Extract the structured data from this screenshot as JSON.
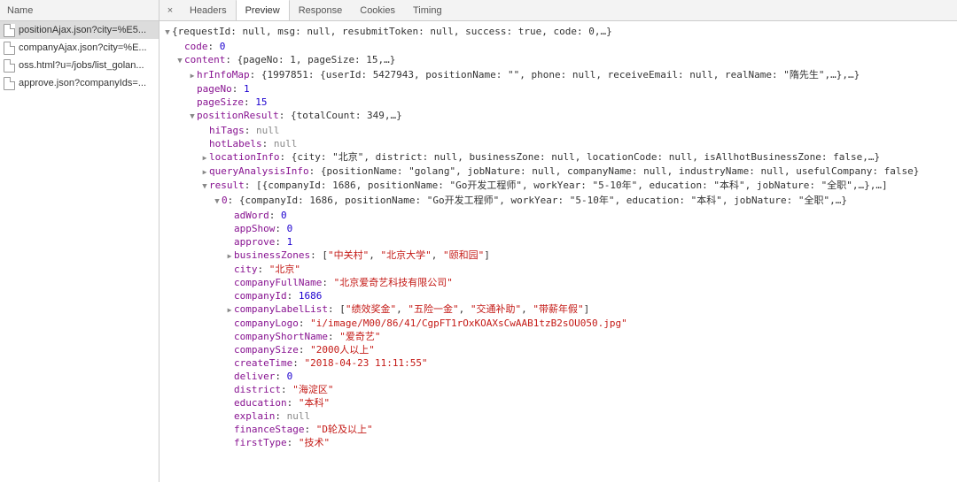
{
  "left_panel": {
    "header": "Name",
    "items": [
      {
        "label": "positionAjax.json?city=%E5...",
        "selected": true
      },
      {
        "label": "companyAjax.json?city=%E...",
        "selected": false
      },
      {
        "label": "oss.html?u=/jobs/list_golan...",
        "selected": false
      },
      {
        "label": "approve.json?companyIds=...",
        "selected": false
      }
    ]
  },
  "tabs": {
    "close": "×",
    "items": [
      "Headers",
      "Preview",
      "Response",
      "Cookies",
      "Timing"
    ],
    "active": 1
  },
  "tree": [
    {
      "d": 0,
      "a": "down",
      "pre": "",
      "key": "",
      "body": [
        [
          "summary",
          "{requestId: null, msg: null, resubmitToken: null, success: true, code: 0,…}"
        ]
      ]
    },
    {
      "d": 1,
      "a": "none",
      "key": "code",
      "body": [
        [
          "punc",
          ": "
        ],
        [
          "num",
          "0"
        ]
      ]
    },
    {
      "d": 1,
      "a": "down",
      "key": "content",
      "body": [
        [
          "punc",
          ": "
        ],
        [
          "summary",
          "{pageNo: 1, pageSize: 15,…}"
        ]
      ]
    },
    {
      "d": 2,
      "a": "right",
      "key": "hrInfoMap",
      "body": [
        [
          "punc",
          ": "
        ],
        [
          "summary",
          "{1997851: {userId: 5427943, positionName: \"\", phone: null, receiveEmail: null, realName: \"隋先生\",…},…}"
        ]
      ]
    },
    {
      "d": 2,
      "a": "none",
      "key": "pageNo",
      "body": [
        [
          "punc",
          ": "
        ],
        [
          "num",
          "1"
        ]
      ]
    },
    {
      "d": 2,
      "a": "none",
      "key": "pageSize",
      "body": [
        [
          "punc",
          ": "
        ],
        [
          "num",
          "15"
        ]
      ]
    },
    {
      "d": 2,
      "a": "down",
      "key": "positionResult",
      "body": [
        [
          "punc",
          ": "
        ],
        [
          "summary",
          "{totalCount: 349,…}"
        ]
      ]
    },
    {
      "d": 3,
      "a": "none",
      "key": "hiTags",
      "body": [
        [
          "punc",
          ": "
        ],
        [
          "null",
          "null"
        ]
      ]
    },
    {
      "d": 3,
      "a": "none",
      "key": "hotLabels",
      "body": [
        [
          "punc",
          ": "
        ],
        [
          "null",
          "null"
        ]
      ]
    },
    {
      "d": 3,
      "a": "right",
      "key": "locationInfo",
      "body": [
        [
          "punc",
          ": "
        ],
        [
          "summary",
          "{city: \"北京\", district: null, businessZone: null, locationCode: null, isAllhotBusinessZone: false,…}"
        ]
      ]
    },
    {
      "d": 3,
      "a": "right",
      "key": "queryAnalysisInfo",
      "body": [
        [
          "punc",
          ": "
        ],
        [
          "summary",
          "{positionName: \"golang\", jobNature: null, companyName: null, industryName: null, usefulCompany: false}"
        ]
      ]
    },
    {
      "d": 3,
      "a": "down",
      "key": "result",
      "body": [
        [
          "punc",
          ": "
        ],
        [
          "summary",
          "[{companyId: 1686, positionName: \"Go开发工程师\", workYear: \"5-10年\", education: \"本科\", jobNature: \"全职\",…},…]"
        ]
      ]
    },
    {
      "d": 4,
      "a": "down",
      "key": "0",
      "body": [
        [
          "punc",
          ": "
        ],
        [
          "summary",
          "{companyId: 1686, positionName: \"Go开发工程师\", workYear: \"5-10年\", education: \"本科\", jobNature: \"全职\",…}"
        ]
      ]
    },
    {
      "d": 5,
      "a": "none",
      "key": "adWord",
      "body": [
        [
          "punc",
          ": "
        ],
        [
          "num",
          "0"
        ]
      ]
    },
    {
      "d": 5,
      "a": "none",
      "key": "appShow",
      "body": [
        [
          "punc",
          ": "
        ],
        [
          "num",
          "0"
        ]
      ]
    },
    {
      "d": 5,
      "a": "none",
      "key": "approve",
      "body": [
        [
          "punc",
          ": "
        ],
        [
          "num",
          "1"
        ]
      ]
    },
    {
      "d": 5,
      "a": "right",
      "key": "businessZones",
      "body": [
        [
          "punc",
          ": ["
        ],
        [
          "str",
          "\"中关村\""
        ],
        [
          "punc",
          ", "
        ],
        [
          "str",
          "\"北京大学\""
        ],
        [
          "punc",
          ", "
        ],
        [
          "str",
          "\"颐和园\""
        ],
        [
          "punc",
          "]"
        ]
      ]
    },
    {
      "d": 5,
      "a": "none",
      "key": "city",
      "body": [
        [
          "punc",
          ": "
        ],
        [
          "str",
          "\"北京\""
        ]
      ]
    },
    {
      "d": 5,
      "a": "none",
      "key": "companyFullName",
      "body": [
        [
          "punc",
          ": "
        ],
        [
          "str",
          "\"北京爱奇艺科技有限公司\""
        ]
      ]
    },
    {
      "d": 5,
      "a": "none",
      "key": "companyId",
      "body": [
        [
          "punc",
          ": "
        ],
        [
          "num",
          "1686"
        ]
      ]
    },
    {
      "d": 5,
      "a": "right",
      "key": "companyLabelList",
      "body": [
        [
          "punc",
          ": ["
        ],
        [
          "str",
          "\"绩效奖金\""
        ],
        [
          "punc",
          ", "
        ],
        [
          "str",
          "\"五险一金\""
        ],
        [
          "punc",
          ", "
        ],
        [
          "str",
          "\"交通补助\""
        ],
        [
          "punc",
          ", "
        ],
        [
          "str",
          "\"带薪年假\""
        ],
        [
          "punc",
          "]"
        ]
      ]
    },
    {
      "d": 5,
      "a": "none",
      "key": "companyLogo",
      "body": [
        [
          "punc",
          ": "
        ],
        [
          "str",
          "\"i/image/M00/86/41/CgpFT1rOxKOAXsCwAAB1tzB2sOU050.jpg\""
        ]
      ]
    },
    {
      "d": 5,
      "a": "none",
      "key": "companyShortName",
      "body": [
        [
          "punc",
          ": "
        ],
        [
          "str",
          "\"爱奇艺\""
        ]
      ]
    },
    {
      "d": 5,
      "a": "none",
      "key": "companySize",
      "body": [
        [
          "punc",
          ": "
        ],
        [
          "str",
          "\"2000人以上\""
        ]
      ]
    },
    {
      "d": 5,
      "a": "none",
      "key": "createTime",
      "body": [
        [
          "punc",
          ": "
        ],
        [
          "str",
          "\"2018-04-23 11:11:55\""
        ]
      ]
    },
    {
      "d": 5,
      "a": "none",
      "key": "deliver",
      "body": [
        [
          "punc",
          ": "
        ],
        [
          "num",
          "0"
        ]
      ]
    },
    {
      "d": 5,
      "a": "none",
      "key": "district",
      "body": [
        [
          "punc",
          ": "
        ],
        [
          "str",
          "\"海淀区\""
        ]
      ]
    },
    {
      "d": 5,
      "a": "none",
      "key": "education",
      "body": [
        [
          "punc",
          ": "
        ],
        [
          "str",
          "\"本科\""
        ]
      ]
    },
    {
      "d": 5,
      "a": "none",
      "key": "explain",
      "body": [
        [
          "punc",
          ": "
        ],
        [
          "null",
          "null"
        ]
      ]
    },
    {
      "d": 5,
      "a": "none",
      "key": "financeStage",
      "body": [
        [
          "punc",
          ": "
        ],
        [
          "str",
          "\"D轮及以上\""
        ]
      ]
    },
    {
      "d": 5,
      "a": "none",
      "key": "firstType",
      "body": [
        [
          "punc",
          ": "
        ],
        [
          "str",
          "\"技术\""
        ]
      ]
    }
  ]
}
